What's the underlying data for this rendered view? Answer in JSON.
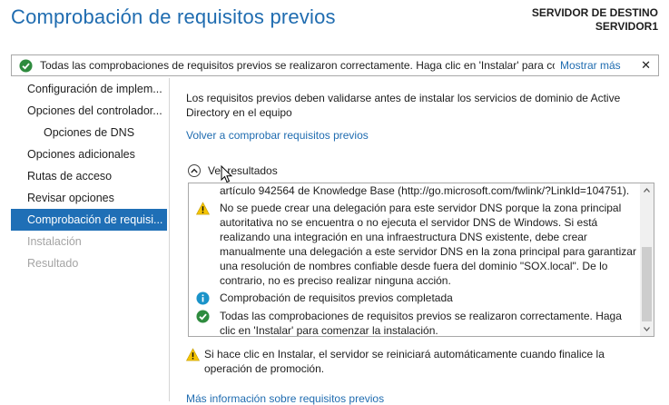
{
  "header": {
    "title": "Comprobación de requisitos previos",
    "dest_label": "SERVIDOR DE DESTINO",
    "dest_server": "SERVIDOR1"
  },
  "banner": {
    "text": "Todas las comprobaciones de requisitos previos se realizaron correctamente. Haga clic en 'Instalar' para co...",
    "more": "Mostrar más",
    "close": "✕"
  },
  "nav": {
    "items": [
      {
        "label": "Configuración de implem..."
      },
      {
        "label": "Opciones del controlador..."
      },
      {
        "label": "Opciones de DNS"
      },
      {
        "label": "Opciones adicionales"
      },
      {
        "label": "Rutas de acceso"
      },
      {
        "label": "Revisar opciones"
      },
      {
        "label": "Comprobación de requisi..."
      },
      {
        "label": "Instalación"
      },
      {
        "label": "Resultado"
      }
    ]
  },
  "main": {
    "intro": "Los requisitos previos deben validarse antes de instalar los servicios de dominio de Active Directory en el equipo",
    "recheck": "Volver a comprobar requisitos previos",
    "toggle": "Ver resultados",
    "results": [
      {
        "text": "artículo 942564 de Knowledge Base (http://go.microsoft.com/fwlink/?LinkId=104751)."
      },
      {
        "text": "No se puede crear una delegación para este servidor DNS porque la zona principal autoritativa no se encuentra o no ejecuta el servidor DNS de Windows. Si está realizando una integración en una infraestructura DNS existente, debe crear manualmente una delegación a este servidor DNS en la zona principal para garantizar una resolución de nombres confiable desde fuera del dominio \"SOX.local\". De lo contrario, no es preciso realizar ninguna acción."
      },
      {
        "text": "Comprobación de requisitos previos completada"
      },
      {
        "text": "Todas las comprobaciones de requisitos previos se realizaron correctamente. Haga clic en 'Instalar' para comenzar la instalación."
      }
    ],
    "restart": "Si hace clic en Instalar, el servidor se reiniciará automáticamente cuando finalice la operación de promoción.",
    "more_info": "Más información sobre requisitos previos"
  },
  "colors": {
    "accent": "#1f6cb0",
    "nav_active": "#1f6fb6",
    "success": "#2e8b3e",
    "warning": "#f5c400",
    "info": "#1a93c9"
  }
}
